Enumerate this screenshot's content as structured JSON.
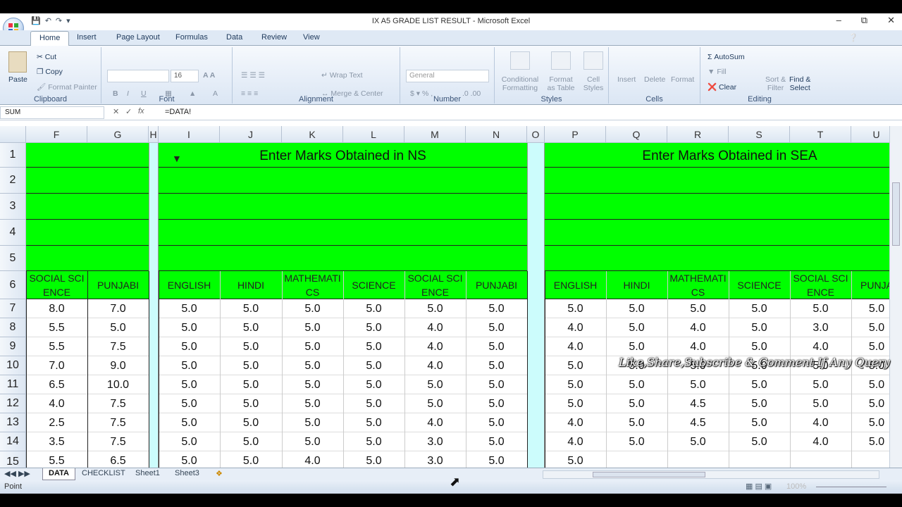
{
  "window": {
    "title": "IX A5 GRADE LIST RESULT - Microsoft Excel"
  },
  "ribbon_tabs": [
    "Home",
    "Insert",
    "Page Layout",
    "Formulas",
    "Data",
    "Review",
    "View"
  ],
  "clipboard": {
    "paste": "Paste",
    "cut": "Cut",
    "copy": "Copy",
    "format_painter": "Format Painter",
    "label": "Clipboard"
  },
  "font": {
    "size": "16",
    "label": "Font"
  },
  "alignment": {
    "wrap": "Wrap Text",
    "merge": "Merge & Center",
    "label": "Alignment"
  },
  "number": {
    "format": "General",
    "label": "Number"
  },
  "styles": {
    "cond": "Conditional",
    "cond2": "Formatting",
    "fmt": "Format",
    "fmt2": "as Table",
    "cell": "Cell",
    "cell2": "Styles",
    "label": "Styles"
  },
  "cells": {
    "insert": "Insert",
    "delete": "Delete",
    "format": "Format",
    "label": "Cells"
  },
  "editing": {
    "autosum": "AutoSum",
    "fill": "Fill",
    "clear": "Clear",
    "sort": "Sort &",
    "sort2": "Filter",
    "find": "Find &",
    "find2": "Select",
    "label": "Editing"
  },
  "formula_bar": {
    "name_box": "SUM",
    "formula": "=DATA!"
  },
  "columns": [
    "F",
    "G",
    "H",
    "I",
    "J",
    "K",
    "L",
    "M",
    "N",
    "O",
    "P",
    "Q",
    "R",
    "S",
    "T",
    "U"
  ],
  "rows": [
    "1",
    "2",
    "3",
    "4",
    "5",
    "6",
    "7",
    "8",
    "9",
    "10",
    "11",
    "12",
    "13",
    "14",
    "15"
  ],
  "headers": {
    "ns": "Enter Marks Obtained in NS",
    "sea": "Enter Marks Obtained in SEA"
  },
  "subjects_left": [
    "SOCIAL SCIENCE",
    "PUNJABI"
  ],
  "subjects_ns": [
    "ENGLISH",
    "HINDI",
    "MATHEMATICS",
    "SCIENCE",
    "SOCIAL SCIENCE",
    "PUNJABI"
  ],
  "subjects_sea": [
    "ENGLISH",
    "HINDI",
    "MATHEMATICS",
    "SCIENCE",
    "SOCIAL SCIENCE",
    "PUNJA"
  ],
  "data_rows": [
    [
      "8.0",
      "7.0",
      "5.0",
      "5.0",
      "5.0",
      "5.0",
      "5.0",
      "5.0",
      "5.0",
      "5.0",
      "5.0",
      "5.0",
      "5.0",
      "5.0"
    ],
    [
      "5.5",
      "5.0",
      "5.0",
      "5.0",
      "5.0",
      "5.0",
      "4.0",
      "5.0",
      "4.0",
      "5.0",
      "4.0",
      "5.0",
      "3.0",
      "5.0"
    ],
    [
      "5.5",
      "7.5",
      "5.0",
      "5.0",
      "5.0",
      "5.0",
      "4.0",
      "5.0",
      "4.0",
      "5.0",
      "4.0",
      "5.0",
      "4.0",
      "5.0"
    ],
    [
      "7.0",
      "9.0",
      "5.0",
      "5.0",
      "5.0",
      "5.0",
      "4.0",
      "5.0",
      "5.0",
      "5.0",
      "5.0",
      "5.0",
      "5.0",
      "5.0"
    ],
    [
      "6.5",
      "10.0",
      "5.0",
      "5.0",
      "5.0",
      "5.0",
      "5.0",
      "5.0",
      "5.0",
      "5.0",
      "5.0",
      "5.0",
      "5.0",
      "5.0"
    ],
    [
      "4.0",
      "7.5",
      "5.0",
      "5.0",
      "5.0",
      "5.0",
      "5.0",
      "5.0",
      "5.0",
      "5.0",
      "4.5",
      "5.0",
      "5.0",
      "5.0"
    ],
    [
      "2.5",
      "7.5",
      "5.0",
      "5.0",
      "5.0",
      "5.0",
      "4.0",
      "5.0",
      "4.0",
      "5.0",
      "4.5",
      "5.0",
      "4.0",
      "5.0"
    ],
    [
      "3.5",
      "7.5",
      "5.0",
      "5.0",
      "5.0",
      "5.0",
      "3.0",
      "5.0",
      "4.0",
      "5.0",
      "5.0",
      "5.0",
      "4.0",
      "5.0"
    ],
    [
      "5.5",
      "6.5",
      "5.0",
      "5.0",
      "4.0",
      "5.0",
      "3.0",
      "5.0",
      "5.0",
      "",
      "",
      "",
      "",
      ""
    ]
  ],
  "sheet_tabs": [
    "DATA",
    "CHECKLIST",
    "Sheet1",
    "Sheet3"
  ],
  "status": {
    "mode": "Point",
    "zoom": "100%"
  },
  "overlay": "Like,Share,Subscribe & Comment If Any Query",
  "colors": {
    "green": "#00ff00",
    "teal": "#ccfcfc"
  }
}
